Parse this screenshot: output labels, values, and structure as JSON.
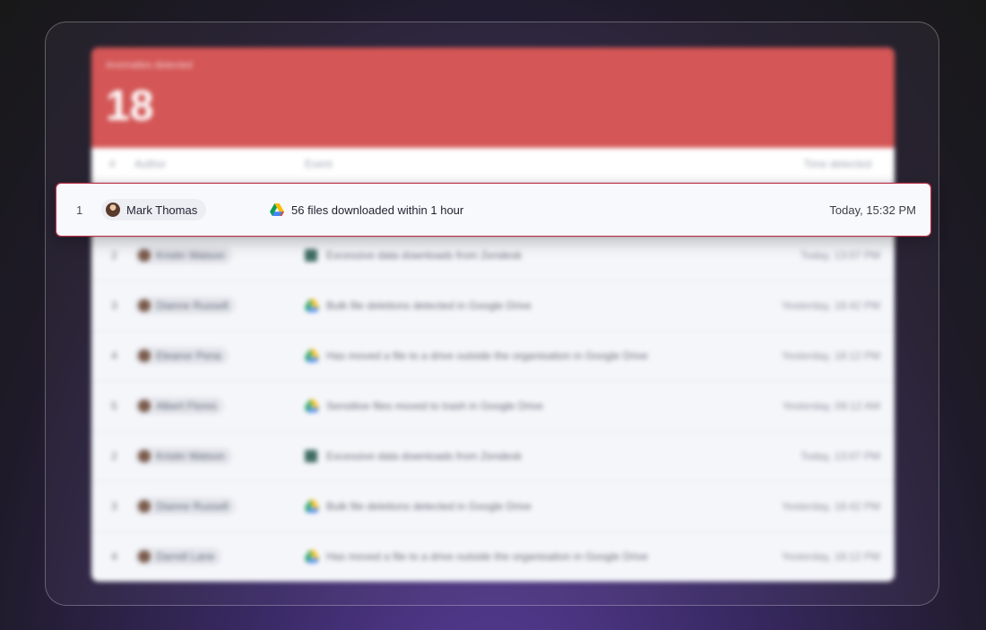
{
  "header": {
    "anomalies_label": "Anomalies detected",
    "anomalies_count": "18"
  },
  "columns": {
    "num": "#",
    "author": "Author",
    "event": "Event",
    "time": "Time detected"
  },
  "highlight": {
    "num": "1",
    "author": "Mark Thomas",
    "event": "56 files downloaded within 1 hour",
    "time": "Today, 15:32 PM",
    "icon": "google-drive-icon"
  },
  "rows": [
    {
      "num": "2",
      "author": "Kristin Watson",
      "event": "Excessive data downloads from Zendesk",
      "time": "Today, 13:07 PM",
      "icon": "zendesk-icon"
    },
    {
      "num": "3",
      "author": "Dianne Russell",
      "event": "Bulk file deletions detected in Google Drive",
      "time": "Yesterday, 18:42 PM",
      "icon": "google-drive-icon"
    },
    {
      "num": "4",
      "author": "Eleanor Pena",
      "event": "Has moved a file to a drive outside the organisation in Google Drive",
      "time": "Yesterday, 18:12 PM",
      "icon": "google-drive-icon"
    },
    {
      "num": "5",
      "author": "Albert Flores",
      "event": "Sensitive files moved to trash in Google Drive",
      "time": "Yesterday, 09:12 AM",
      "icon": "google-drive-icon"
    },
    {
      "num": "2",
      "author": "Kristin Watson",
      "event": "Excessive data downloads from Zendesk",
      "time": "Today, 13:07 PM",
      "icon": "zendesk-icon"
    },
    {
      "num": "3",
      "author": "Dianne Russell",
      "event": "Bulk file deletions detected in Google Drive",
      "time": "Yesterday, 18:42 PM",
      "icon": "google-drive-icon"
    },
    {
      "num": "4",
      "author": "Darrell Lane",
      "event": "Has moved a file to a drive outside the organisation in Google Drive",
      "time": "Yesterday, 18:12 PM",
      "icon": "google-drive-icon"
    }
  ],
  "colors": {
    "header_red": "#d45656",
    "highlight_border": "#b8344a"
  }
}
